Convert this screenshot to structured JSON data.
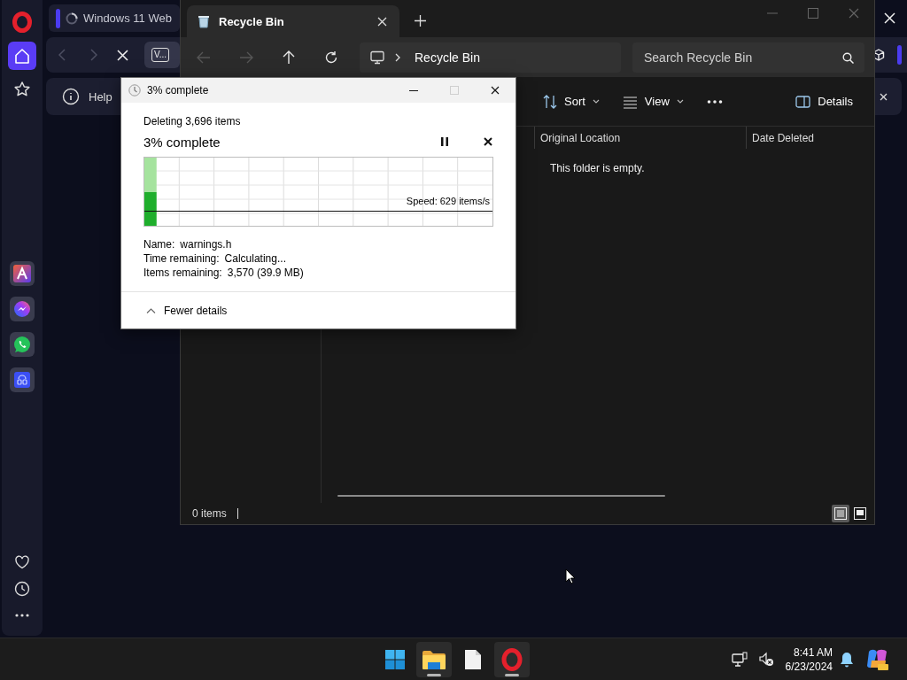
{
  "browser": {
    "sidebar": {
      "top": [
        {
          "kind": "home",
          "selected": true
        },
        {
          "kind": "bookmarks",
          "selected": false
        }
      ],
      "apps": [
        {
          "kind": "aria"
        },
        {
          "kind": "messenger"
        },
        {
          "kind": "whatsapp"
        },
        {
          "kind": "player"
        }
      ],
      "bottom": [
        {
          "kind": "heart"
        },
        {
          "kind": "history"
        },
        {
          "kind": "more"
        }
      ]
    },
    "tabs": [
      {
        "title": "Windows 11 Web",
        "selected": true,
        "loading": true
      }
    ],
    "address_bar": {
      "chip": "V..."
    },
    "info_bar": {
      "text": "Help"
    }
  },
  "explorer": {
    "tabs": [
      {
        "title": "Recycle Bin",
        "selected": true
      }
    ],
    "nav_buttons": [
      {
        "kind": "back",
        "disabled": true
      },
      {
        "kind": "forward",
        "disabled": true
      },
      {
        "kind": "up",
        "disabled": false
      },
      {
        "kind": "refresh",
        "disabled": false
      }
    ],
    "breadcrumb": [
      "Recycle Bin"
    ],
    "search": {
      "placeholder": "Search Recycle Bin"
    },
    "toolbar": [
      {
        "kind": "sort",
        "label": "Sort"
      },
      {
        "kind": "view",
        "label": "View"
      },
      {
        "kind": "more"
      },
      {
        "kind": "details",
        "label": "Details"
      }
    ],
    "columns": [
      "Original Location",
      "Date Deleted"
    ],
    "empty_message": "This folder is empty.",
    "status_bar": {
      "count": "0 items",
      "view_modes": [
        {
          "kind": "details",
          "selected": true
        },
        {
          "kind": "tiles",
          "selected": false
        }
      ]
    }
  },
  "dialog": {
    "title": "3% complete",
    "window_controls": [
      {
        "kind": "minimize",
        "disabled": false
      },
      {
        "kind": "maximize",
        "disabled": true
      },
      {
        "kind": "close",
        "disabled": false
      }
    ],
    "summary": "Deleting 3,696 items",
    "heading": "3% complete",
    "progress": {
      "level": 0.035,
      "speed": "Speed: 629 items/s"
    },
    "details": [
      {
        "label": "Name:",
        "value": "warnings.h"
      },
      {
        "label": "Time remaining:",
        "value": "Calculating..."
      },
      {
        "label": "Items remaining:",
        "value": "3,570 (39.9 MB)"
      }
    ],
    "toggle": {
      "label": "Fewer details",
      "expanded": true
    }
  },
  "taskbar": {
    "apps": [
      {
        "kind": "start",
        "running": false
      },
      {
        "kind": "explorer",
        "running": true
      },
      {
        "kind": "notepad",
        "running": false
      },
      {
        "kind": "opera",
        "running": true
      }
    ],
    "tray": {
      "time": "8:41 AM",
      "date": "6/23/2024"
    }
  }
}
